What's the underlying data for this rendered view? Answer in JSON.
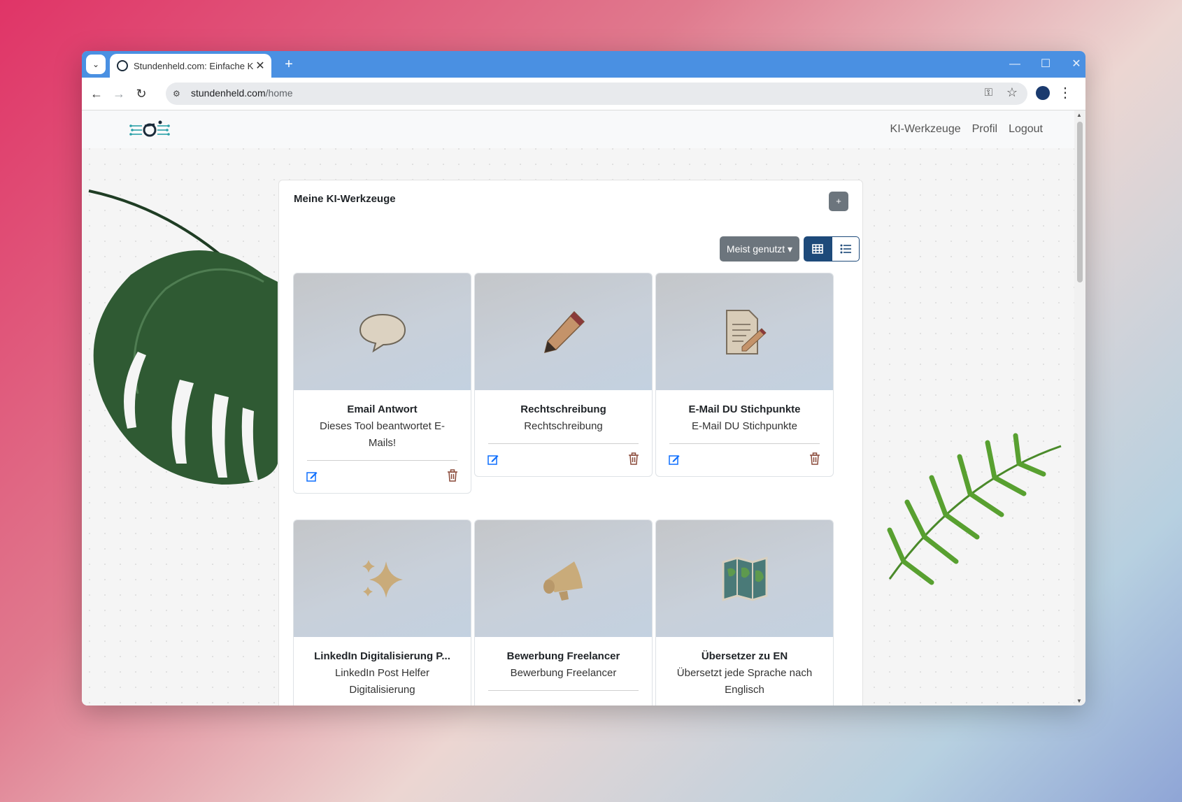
{
  "browser": {
    "tab_title": "Stundenheld.com: Einfache KI-W",
    "url_domain": "stundenheld.com",
    "url_path": "/home",
    "new_tab_label": "+",
    "tab_close": "✕"
  },
  "navbar": {
    "links": [
      "KI-Werkzeuge",
      "Profil",
      "Logout"
    ]
  },
  "panel": {
    "title": "Meine KI-Werkzeuge",
    "add_label": "+",
    "sort_label": "Meist genutzt ▾"
  },
  "cards": [
    {
      "name": "Email Antwort",
      "desc": "Dieses Tool beantwortet E-Mails!",
      "icon": "speech-bubble-icon"
    },
    {
      "name": "Rechtschreibung",
      "desc": "Rechtschreibung",
      "icon": "pencil-icon"
    },
    {
      "name": "E-Mail DU Stichpunkte",
      "desc": "E-Mail DU Stichpunkte",
      "icon": "document-pencil-icon"
    },
    {
      "name": "LinkedIn Digitalisierung P...",
      "desc": "LinkedIn Post Helfer Digitalisierung",
      "icon": "sparkles-icon"
    },
    {
      "name": "Bewerbung Freelancer",
      "desc": "Bewerbung Freelancer",
      "icon": "megaphone-icon"
    },
    {
      "name": "Übersetzer zu EN",
      "desc": "Übersetzt jede Sprache nach Englisch",
      "icon": "world-map-icon"
    }
  ],
  "colors": {
    "titlebar": "#4a90e2",
    "primary": "#1e4a7a",
    "secondary": "#6c757d",
    "icon_tan": "#c9ab7a"
  }
}
